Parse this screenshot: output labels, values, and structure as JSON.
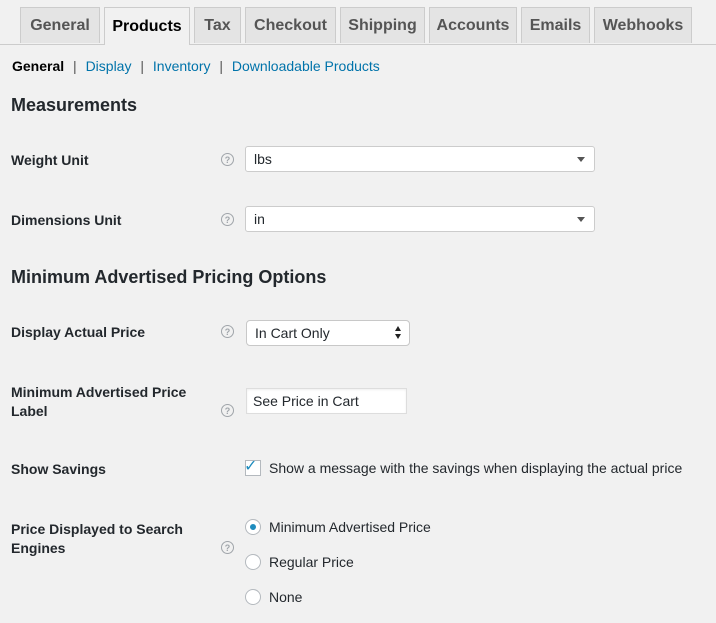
{
  "tabs": [
    {
      "label": "General"
    },
    {
      "label": "Products"
    },
    {
      "label": "Tax"
    },
    {
      "label": "Checkout"
    },
    {
      "label": "Shipping"
    },
    {
      "label": "Accounts"
    },
    {
      "label": "Emails"
    },
    {
      "label": "Webhooks"
    }
  ],
  "active_tab": "Products",
  "subnav": {
    "current": "General",
    "links": [
      "Display",
      "Inventory",
      "Downloadable Products"
    ],
    "separator": "|"
  },
  "sections": {
    "measurements": "Measurements",
    "map": "Minimum Advertised Pricing Options"
  },
  "fields": {
    "weight_unit": {
      "label": "Weight Unit",
      "value": "lbs"
    },
    "dimensions_unit": {
      "label": "Dimensions Unit",
      "value": "in"
    },
    "display_actual_price": {
      "label": "Display Actual Price",
      "value": "In Cart Only"
    },
    "map_label": {
      "label_line1": "Minimum Advertised Price",
      "label_line2": "Label",
      "value": "See Price in Cart"
    },
    "show_savings": {
      "label": "Show Savings",
      "checked": true,
      "text": "Show a message with the savings when displaying the actual price"
    },
    "search_price": {
      "label_line1": "Price Displayed to Search",
      "label_line2": "Engines",
      "options": [
        "Minimum Advertised Price",
        "Regular Price",
        "None"
      ],
      "selected": "Minimum Advertised Price"
    }
  },
  "help_glyph": "?",
  "check_glyph": "✓",
  "colors": {
    "link": "#0073aa",
    "accent": "#1e8cbe",
    "background": "#f1f1f1"
  }
}
